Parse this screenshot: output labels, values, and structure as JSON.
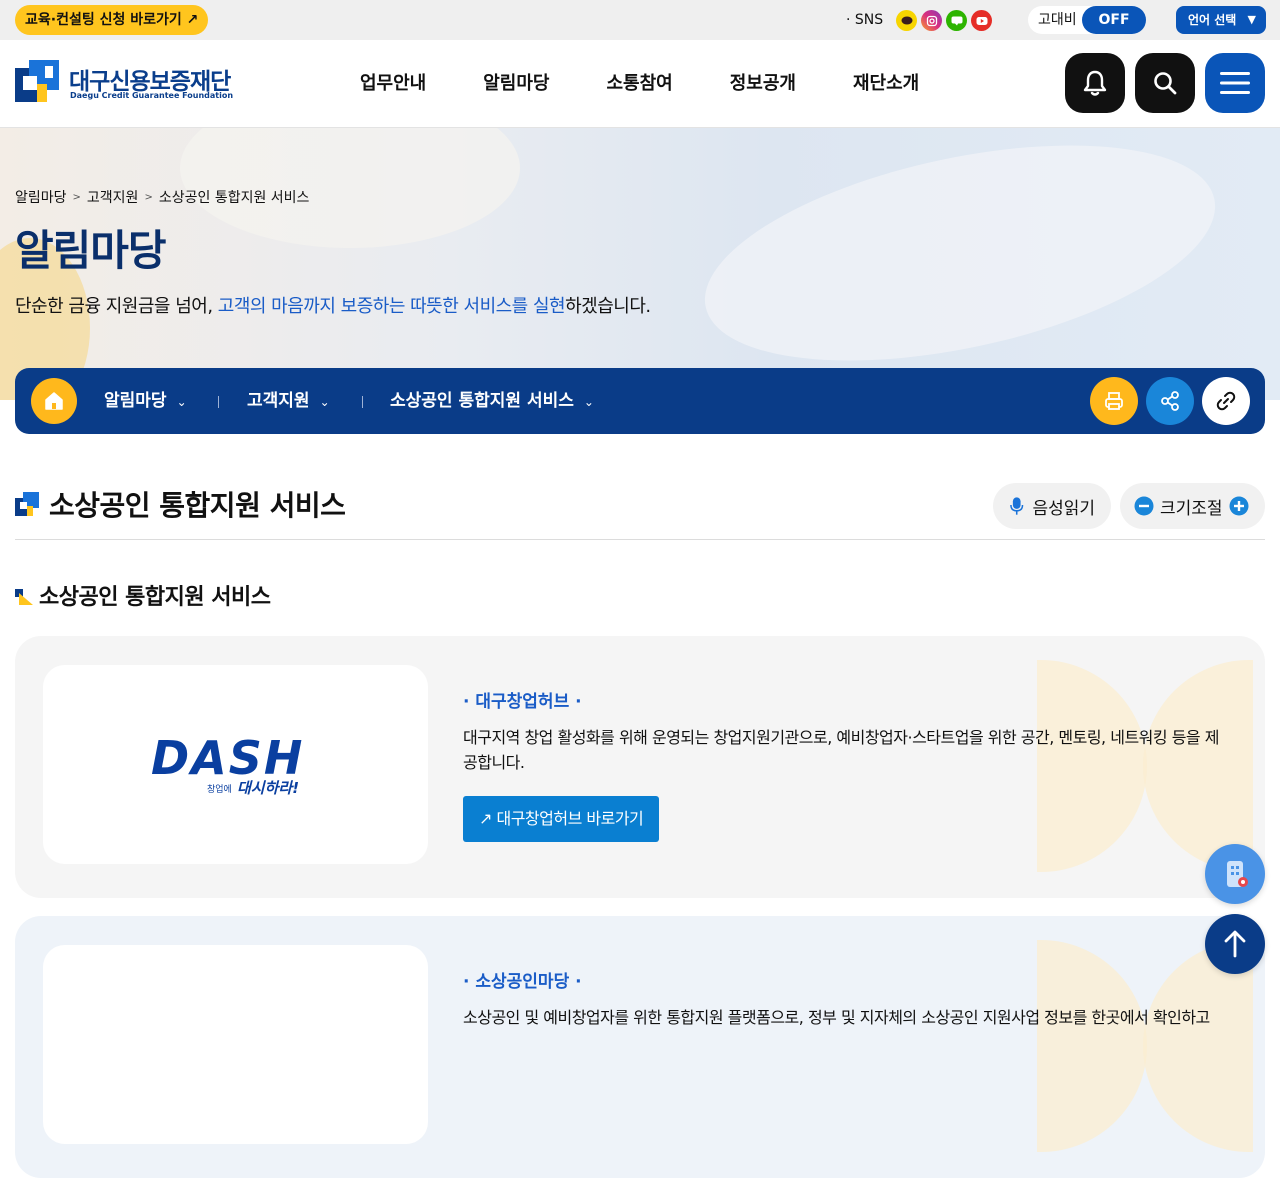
{
  "topbar": {
    "edu_link": "교육·컨설팅 신청 바로가기 ↗",
    "sns_label": "· SNS",
    "sns_icons": [
      "kakao-icon",
      "instagram-icon",
      "blog-icon",
      "youtube-icon"
    ],
    "contrast_label": "고대비",
    "contrast_state": "OFF",
    "language_label": "언어 선택",
    "language_caret": "▼"
  },
  "header": {
    "logo_kr": "대구신용보증재단",
    "logo_en": "Daegu Credit Guarantee Foundation",
    "nav": [
      "업무안내",
      "알림마당",
      "소통참여",
      "정보공개",
      "재단소개"
    ],
    "buttons": [
      "bell-icon",
      "search-icon",
      "menu-icon"
    ]
  },
  "hero": {
    "breadcrumb": [
      "알림마당",
      "고객지원",
      "소상공인 통합지원 서비스"
    ],
    "breadcrumb_sep": ">",
    "title": "알림마당",
    "subtitle_pre": "단순한 금융 지원금을 넘어, ",
    "subtitle_highlight": "고객의 마음까지 보증하는 따뜻한 서비스를 실현",
    "subtitle_post": "하겠습니다."
  },
  "subnav": {
    "items": [
      "알림마당",
      "고객지원",
      "소상공인 통합지원 서비스"
    ],
    "chevron": "⌄",
    "tools": [
      "print-icon",
      "share-icon",
      "link-icon"
    ]
  },
  "content": {
    "page_title": "소상공인 통합지원 서비스",
    "voice_label": "음성읽기",
    "size_label": "크기조절",
    "section_title": "소상공인 통합지원 서비스",
    "cards": [
      {
        "logo_text": "DASH",
        "logo_sub_small": "창업에",
        "logo_sub": "대시하라!",
        "name": "· 대구창업허브 ·",
        "desc": "대구지역 창업 활성화를 위해 운영되는 창업지원기관으로, 예비창업자·스타트업을 위한 공간, 멘토링, 네트워킹 등을 제공합니다.",
        "link": "↗ 대구창업허브 바로가기"
      },
      {
        "name": "· 소상공인마당 ·",
        "desc": "소상공인 및 예비창업자를 위한 통합지원 플랫폼으로, 정부 및 지자체의 소상공인 지원사업 정보를 한곳에서 확인하고"
      }
    ]
  },
  "colors": {
    "brand_blue": "#0a3c88",
    "accent_blue": "#0a55b8",
    "accent_yellow": "#ffc51e",
    "link_blue": "#0a7fd1"
  }
}
